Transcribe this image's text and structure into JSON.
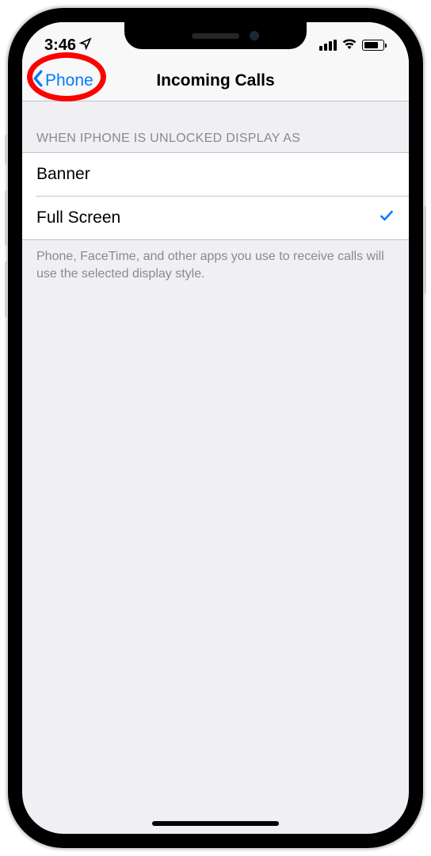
{
  "statusBar": {
    "time": "3:46"
  },
  "navBar": {
    "backLabel": "Phone",
    "title": "Incoming Calls"
  },
  "section": {
    "header": "WHEN IPHONE IS UNLOCKED DISPLAY AS",
    "options": [
      {
        "label": "Banner",
        "selected": false
      },
      {
        "label": "Full Screen",
        "selected": true
      }
    ],
    "footer": "Phone, FaceTime, and other apps you use to receive calls will use the selected display style."
  }
}
